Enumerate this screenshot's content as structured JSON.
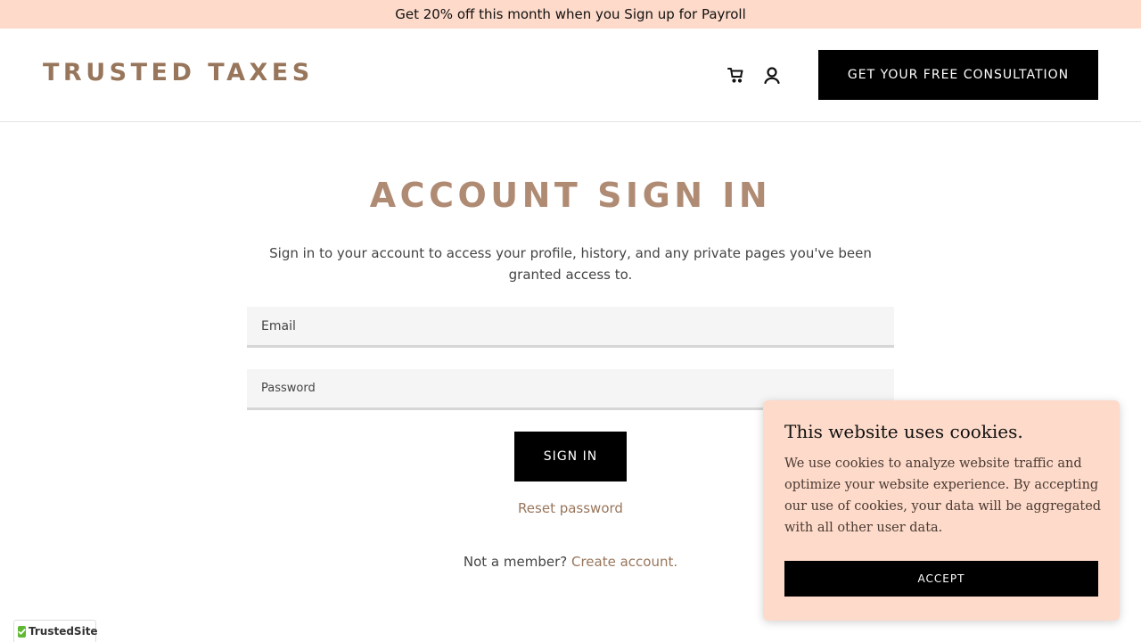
{
  "promo": {
    "text": "Get 20% off this month when you Sign up for Payroll"
  },
  "header": {
    "logo": "TRUSTED TAXES",
    "cta_label": "GET YOUR FREE CONSULTATION",
    "icons": [
      "cart-icon",
      "user-icon"
    ]
  },
  "main": {
    "title": "ACCOUNT SIGN IN",
    "intro": "Sign in to your account to access your profile, history, and any private pages you've been granted access to.",
    "email_placeholder": "Email",
    "password_placeholder": "Password",
    "signin_label": "SIGN IN",
    "reset_label": "Reset password",
    "member_prefix": "Not a member?",
    "create_label": "Create account."
  },
  "cookie": {
    "title": "This website uses cookies.",
    "text": "We use cookies to analyze website traffic and optimize your website experience. By accepting our use of cookies, your data will be aggregated with all other user data.",
    "accept_label": "ACCEPT"
  },
  "badge": {
    "label": "TrustedSite"
  },
  "colors": {
    "promo_bg": "#fddac9",
    "brand_brown": "#98765c",
    "title_brown": "#b08b74",
    "button_black": "#000000",
    "badge_green": "#5fb832"
  }
}
